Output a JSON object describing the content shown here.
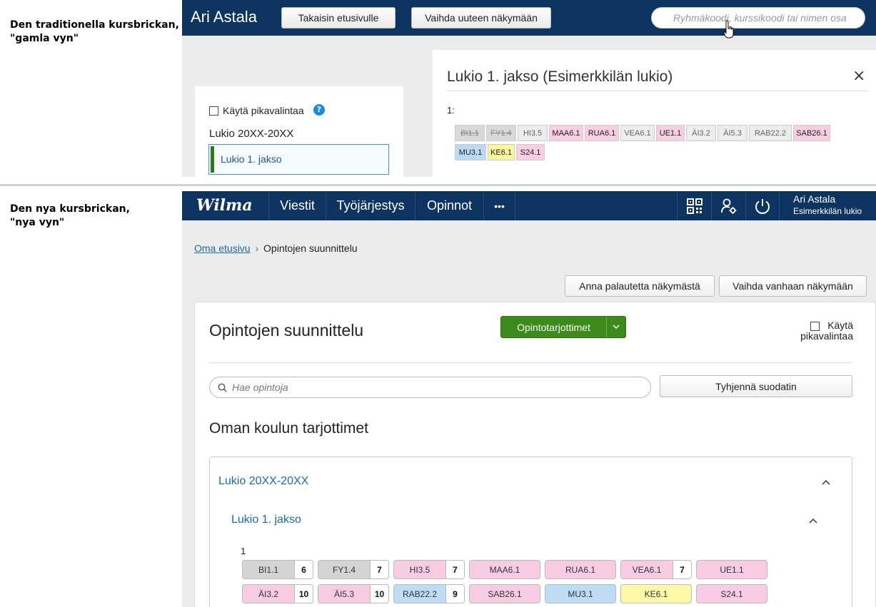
{
  "captions": {
    "old": "Den traditionella kursbrickan,\n\"gamla vyn\"",
    "new": "Den nya kursbrickan,\n\"nya vyn\""
  },
  "old_view": {
    "user_name": "Ari Astala",
    "back_button": "Takaisin etusivulle",
    "switch_button": "Vaihda uuteen näkymään",
    "search_placeholder": "Ryhmäkoodi, kurssikoodi tai nimen osa",
    "quick_select_label": "Käytä pikavalintaa",
    "help_label": "?",
    "year_label": "Lukio 20XX-20XX",
    "period_label": "Lukio 1. jakso",
    "panel_title": "Lukio 1. jakso (Esimerkkilän lukio)",
    "close_label": "×",
    "row_number": "1:",
    "chips": [
      {
        "code": "BI1.1",
        "status": "struck"
      },
      {
        "code": "FY1.4",
        "status": "struck"
      },
      {
        "code": "HI3.5",
        "status": "grey"
      },
      {
        "code": "MAA6.1",
        "status": "pink"
      },
      {
        "code": "RUA6.1",
        "status": "pink"
      },
      {
        "code": "VEA6.1",
        "status": "grey"
      },
      {
        "code": "UE1.1",
        "status": "pink"
      },
      {
        "code": "ÄI3.2",
        "status": "grey"
      },
      {
        "code": "ÄI5.3",
        "status": "grey"
      },
      {
        "code": "RAB22.2",
        "status": "grey"
      },
      {
        "code": "SAB26.1",
        "status": "pink"
      },
      {
        "code": "MU3.1",
        "status": "blue"
      },
      {
        "code": "KE6.1",
        "status": "yellow"
      },
      {
        "code": "S24.1",
        "status": "pink"
      }
    ]
  },
  "new_view": {
    "logo": "Wilma",
    "nav": [
      "Viestit",
      "Työjärjestys",
      "Opinnot",
      "•••"
    ],
    "user_name": "Ari Astala",
    "school": "Esimerkkilän lukio",
    "breadcrumb_home": "Oma etusivu",
    "breadcrumb_sep": "›",
    "breadcrumb_current": "Opintojen suunnittelu",
    "feedback_button": "Anna palautetta näkymästä",
    "switch_old_button": "Vaihda vanhaan näkymään",
    "page_title": "Opintojen suunnittelu",
    "offerings_button": "Opintotarjottimet",
    "quick_select_label": "Käytä pikavalintaa",
    "search_placeholder": "Hae opintoja",
    "clear_filter_button": "Tyhjennä suodatin",
    "section_heading": "Oman koulun tarjottimet",
    "year_label": "Lukio 20XX-20XX",
    "period_label": "Lukio 1. jakso",
    "row_number": "1",
    "chips": [
      {
        "code": "BI1.1",
        "count": "6",
        "color": "#d4d4d4"
      },
      {
        "code": "FY1.4",
        "count": "7",
        "color": "#d4d4d4"
      },
      {
        "code": "HI3.5",
        "count": "7",
        "color": "#f8cde3"
      },
      {
        "code": "MAA6.1",
        "count": "",
        "color": "#f8cde3"
      },
      {
        "code": "RUA6.1",
        "count": "",
        "color": "#f8cde3"
      },
      {
        "code": "VEA6.1",
        "count": "7",
        "color": "#f8cde3"
      },
      {
        "code": "UE1.1",
        "count": "",
        "color": "#f8cde3"
      },
      {
        "code": "ÄI3.2",
        "count": "10",
        "color": "#f8cde3"
      },
      {
        "code": "ÄI5.3",
        "count": "10",
        "color": "#f8cde3"
      },
      {
        "code": "RAB22.2",
        "count": "9",
        "color": "#bfdcf7"
      },
      {
        "code": "SAB26.1",
        "count": "",
        "color": "#f8cde3"
      },
      {
        "code": "MU3.1",
        "count": "",
        "color": "#bfdcf7"
      },
      {
        "code": "KE6.1",
        "count": "",
        "color": "#fbf8a8"
      },
      {
        "code": "S24.1",
        "count": "",
        "color": "#f8cde3"
      }
    ]
  }
}
